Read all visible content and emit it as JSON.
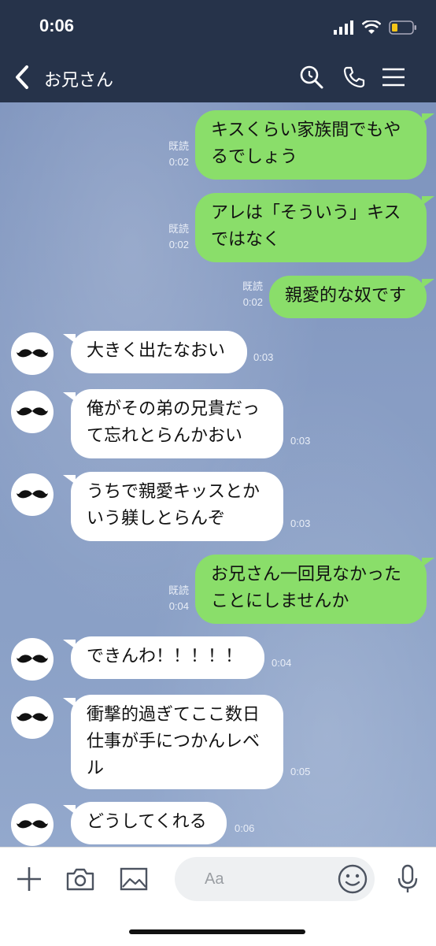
{
  "status_bar": {
    "time": "0:06"
  },
  "header": {
    "title": "お兄さん"
  },
  "messages": [
    {
      "side": "out",
      "text": "キスくらい家族間でもや\nるでしょう",
      "read": "既読",
      "time": "0:02"
    },
    {
      "side": "out",
      "text": "アレは「そういう」キス\nではなく",
      "read": "既読",
      "time": "0:02"
    },
    {
      "side": "out",
      "text": "親愛的な奴です",
      "read": "既読",
      "time": "0:02"
    },
    {
      "side": "in",
      "text": "大きく出たなおい",
      "time": "0:03"
    },
    {
      "side": "in",
      "text": "俺がその弟の兄貴だっ\nて忘れとらんかおい",
      "time": "0:03"
    },
    {
      "side": "in",
      "text": "うちで親愛キッスとか\nいう躾しとらんぞ",
      "time": "0:03"
    },
    {
      "side": "out",
      "text": "お兄さん一回見なかった\nことにしませんか",
      "read": "既読",
      "time": "0:04"
    },
    {
      "side": "in",
      "text": "できんわ！！！！！",
      "time": "0:04"
    },
    {
      "side": "in",
      "text": "衝撃的過ぎてここ数日\n仕事が手につかんレベ\nル",
      "time": "0:05"
    },
    {
      "side": "in",
      "text": "どうしてくれる",
      "time": "0:06"
    }
  ],
  "input_bar": {
    "placeholder": "Aa"
  },
  "colors": {
    "header_bg": "#26334a",
    "bubble_out": "#8ade6a",
    "bubble_in": "#ffffff",
    "chat_bg": "#889dc4"
  },
  "icons": [
    "back-arrow-icon",
    "search-icon",
    "phone-icon",
    "menu-icon",
    "plus-icon",
    "camera-icon",
    "image-icon",
    "emoji-icon",
    "microphone-icon",
    "mustache-avatar-icon"
  ]
}
